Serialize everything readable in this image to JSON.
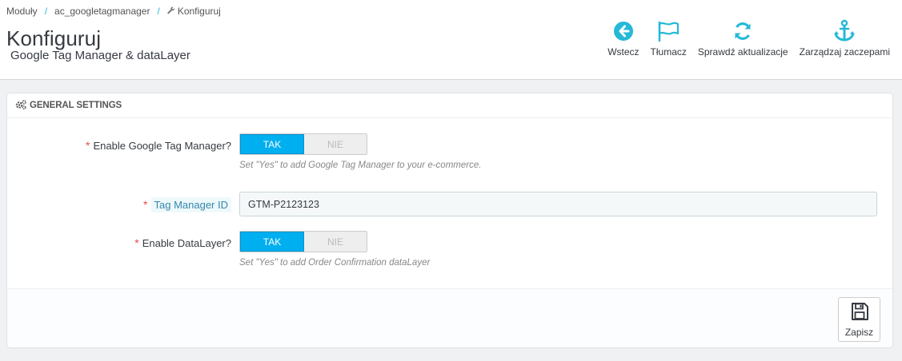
{
  "breadcrumb": {
    "items": [
      "Moduły",
      "ac_googletagmanager",
      "Konfiguruj"
    ],
    "separator": "/"
  },
  "header": {
    "title": "Konfiguruj",
    "subtitle": "Google Tag Manager & dataLayer"
  },
  "toolbar": {
    "back_label": "Wstecz",
    "translate_label": "Tłumacz",
    "check_updates_label": "Sprawdź aktualizacje",
    "manage_hooks_label": "Zarządzaj zaczepami"
  },
  "panel": {
    "heading": "GENERAL SETTINGS",
    "fields": {
      "enable_gtm": {
        "label": "Enable Google Tag Manager?",
        "on_label": "TAK",
        "off_label": "NIE",
        "help": "Set \"Yes\" to add Google Tag Manager to your e-commerce."
      },
      "tag_manager_id": {
        "label": "Tag Manager ID",
        "value": "GTM-P2123123"
      },
      "enable_datalayer": {
        "label": "Enable DataLayer?",
        "on_label": "TAK",
        "off_label": "NIE",
        "help": "Set \"Yes\" to add Order Confirmation dataLayer"
      }
    },
    "required_marker": "*",
    "save_label": "Zapisz"
  },
  "colors": {
    "accent": "#25b9d7",
    "switch_on": "#00aff0",
    "required": "#e84e4e"
  }
}
